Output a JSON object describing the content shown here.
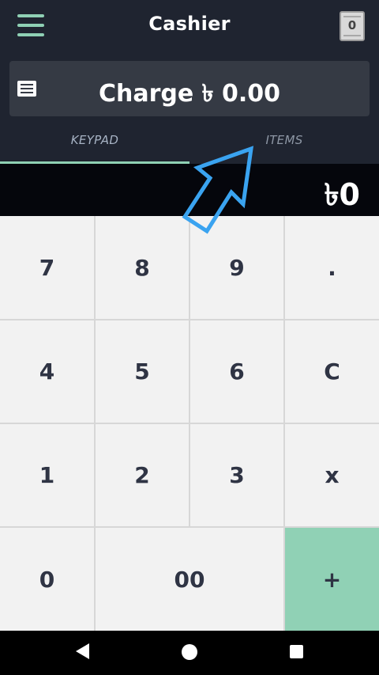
{
  "header": {
    "title": "Cashier",
    "menu_icon": "hamburger-menu-icon",
    "receipt_icon": "receipt-icon",
    "receipt_count": "0"
  },
  "charge": {
    "label": "Charge ৳ 0.00",
    "icon": "list-icon"
  },
  "tabs": [
    {
      "label": "KEYPAD",
      "active": true
    },
    {
      "label": "ITEMS",
      "active": false
    }
  ],
  "display": {
    "amount": "৳0"
  },
  "keypad": {
    "keys": [
      "7",
      "8",
      "9",
      ".",
      "4",
      "5",
      "6",
      "C",
      "1",
      "2",
      "3",
      "x",
      "0",
      "00",
      "+"
    ]
  },
  "annotation": {
    "icon": "arrow-pointing-to-items-tab",
    "color": "#3aa3f0"
  },
  "colors": {
    "background": "#1f2430",
    "accent": "#8fd0b4",
    "charge_bar": "#353a44",
    "display": "#05060c",
    "key": "#f2f2f2",
    "key_text": "#2f3444"
  },
  "navbar": {
    "back_icon": "back-triangle-icon",
    "home_icon": "home-circle-icon",
    "recents_icon": "recents-square-icon"
  }
}
